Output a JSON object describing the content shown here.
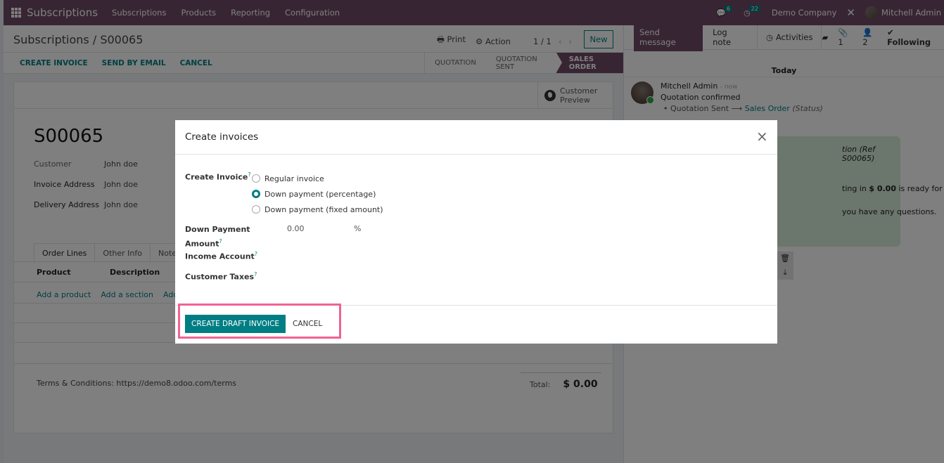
{
  "navbar": {
    "app_name": "Subscriptions",
    "menu": [
      "Subscriptions",
      "Products",
      "Reporting",
      "Configuration"
    ],
    "messages_count": "6",
    "activities_count": "22",
    "company": "Demo Company",
    "user": "Mitchell Admin"
  },
  "control_panel": {
    "breadcrumb": "Subscriptions / S00065",
    "print_label": "Print",
    "action_label": "Action",
    "pager": "1 / 1",
    "new_label": "New",
    "header_buttons": [
      "CREATE INVOICE",
      "SEND BY EMAIL",
      "CANCEL"
    ],
    "stages": [
      "QUOTATION",
      "QUOTATION SENT",
      "SALES ORDER"
    ],
    "active_stage": "SALES ORDER"
  },
  "form": {
    "customer_preview": "Customer Preview",
    "record_name": "S00065",
    "fields": [
      {
        "label": "Customer",
        "value": "John doe"
      },
      {
        "label": "Invoice Address",
        "value": "John doe"
      },
      {
        "label": "Delivery Address",
        "value": "John doe"
      }
    ],
    "tabs": [
      "Order Lines",
      "Other Info",
      "Notes"
    ],
    "columns": [
      "Product",
      "Description"
    ],
    "add_links": [
      "Add a product",
      "Add a section",
      "Add a note"
    ],
    "terms": "Terms & Conditions: https://demo8.odoo.com/terms",
    "total_label": "Total:",
    "total_value": "$ 0.00"
  },
  "chatter": {
    "send_message": "Send message",
    "log_note": "Log note",
    "activities": "Activities",
    "attachments_count": "1",
    "followers_count": "2",
    "following": "Following",
    "date_separator": "Today",
    "message": {
      "author": "Mitchell Admin",
      "time": "- now",
      "body": "Quotation confirmed",
      "tracking_old": "Quotation Sent",
      "tracking_new": "Sales Order",
      "tracking_field": "(Status)"
    },
    "mail_card": {
      "line1": "tion (Ref S00065)",
      "line2_pre": "ting in ",
      "line2_amount": "$ 0.00",
      "line2_post": " is ready for review.",
      "line3": "you have any questions."
    }
  },
  "dialog": {
    "title": "Create invoices",
    "create_invoice_label": "Create Invoice",
    "options": [
      "Regular invoice",
      "Down payment (percentage)",
      "Down payment (fixed amount)"
    ],
    "selected_option": 1,
    "down_payment_label_1": "Down Payment",
    "down_payment_label_2": "Amount",
    "down_payment_value": "0.00",
    "down_payment_unit": "%",
    "income_account_label": "Income Account",
    "customer_taxes_label": "Customer Taxes",
    "help_mark": "?",
    "primary_button": "CREATE DRAFT INVOICE",
    "cancel_button": "CANCEL",
    "highlight_color": "#f06292"
  },
  "colors": {
    "brand": "#714b67",
    "accent": "#017e84"
  }
}
